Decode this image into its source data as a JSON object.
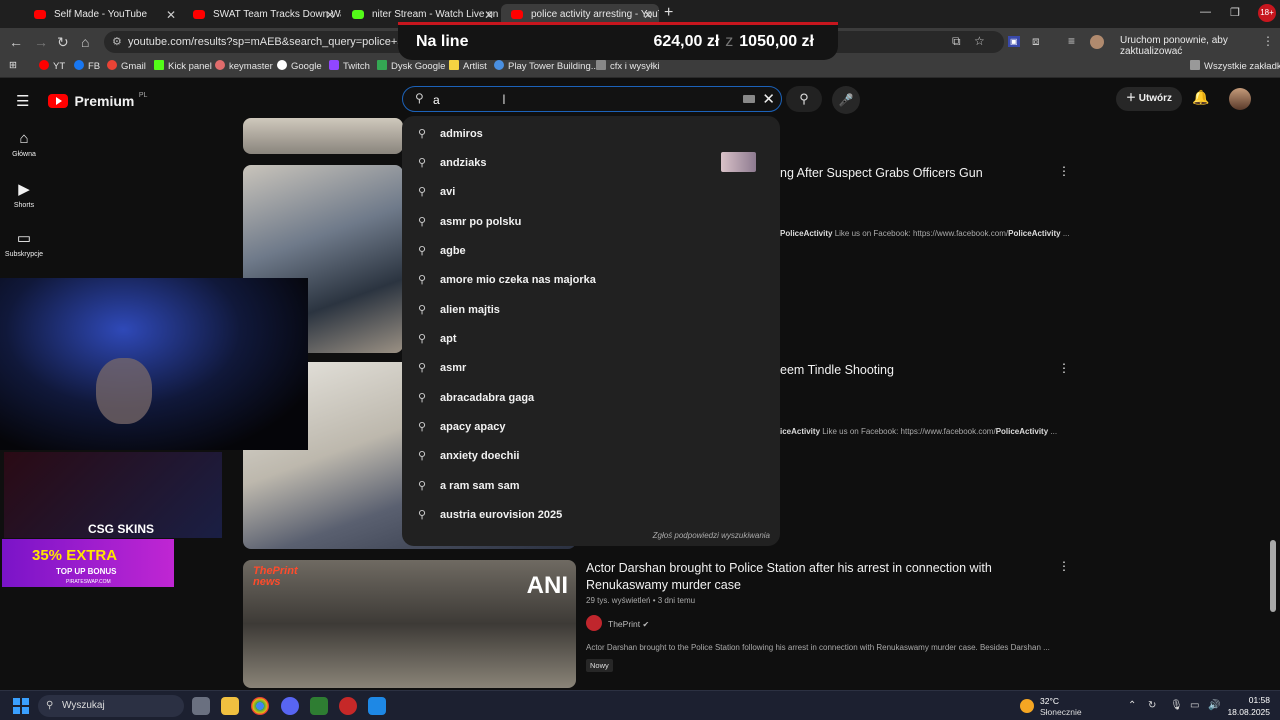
{
  "browser": {
    "tabs": [
      {
        "title": "Self Made - YouTube",
        "favicon_color": "#ff0000"
      },
      {
        "title": "SWAT Team Tracks Down Want",
        "favicon_color": "#ff0000"
      },
      {
        "title": "niter Stream - Watch Live on Ki",
        "favicon_color": "#53fc18"
      },
      {
        "title": "police activity arresting - YouTu",
        "favicon_color": "#ff0000"
      }
    ],
    "url": "youtube.com/results?sp=mAEB&search_query=police+activity+ar",
    "restart_label": "Uruchom ponownie, aby zaktualizować"
  },
  "bookmarks": [
    {
      "label": "YT",
      "color": "#ff0000"
    },
    {
      "label": "FB",
      "color": "#1877f2"
    },
    {
      "label": "Gmail",
      "color": "#ea4335"
    },
    {
      "label": "Kick panel",
      "color": "#53fc18"
    },
    {
      "label": "keymaster",
      "color": "#e06c6c"
    },
    {
      "label": "Google",
      "color": "#ffffff"
    },
    {
      "label": "Twitch",
      "color": "#9146ff"
    },
    {
      "label": "Dysk Google",
      "color": "#34a853"
    },
    {
      "label": "Artlist",
      "color": "#f5d442"
    },
    {
      "label": "Play Tower Building...",
      "color": "#4a90e2"
    },
    {
      "label": "cfx i wysyłki",
      "color": "#888888"
    }
  ],
  "all_bookmarks": "Wszystkie zakładki",
  "overlay_banner": {
    "label": "Na line",
    "value1": "624,00 zł",
    "separator": "z",
    "value2": "1050,00 zł"
  },
  "yt_header": {
    "logo_text": "Premium",
    "logo_region": "PL",
    "search_value": "a",
    "create_label": "Utwórz"
  },
  "sidebar": [
    {
      "label": "Główna",
      "icon": "home-icon"
    },
    {
      "label": "Shorts",
      "icon": "shorts-icon"
    },
    {
      "label": "Subskrypcje",
      "icon": "subscriptions-icon"
    }
  ],
  "suggestions": [
    "admiros",
    "andziaks",
    "avi",
    "asmr po polsku",
    "agbe",
    "amore mio czeka nas majorka",
    "alien majtis",
    "apt",
    "asmr",
    "abracadabra gaga",
    "apacy apacy",
    "anxiety doechii",
    "a ram sam sam",
    "austria eurovision 2025"
  ],
  "report_suggestions": "Zgłoś podpowiedzi wyszukiwania",
  "results": [
    {
      "title_fragment": "ng After Suspect Grabs Officers Gun",
      "desc_channel": "PoliceActivity",
      "desc_text": " Like us on Facebook: https://www.facebook.com/",
      "desc_link": "PoliceActivity",
      "desc_end": " ..."
    },
    {
      "title_fragment": "eem Tindle Shooting",
      "desc_channel": "iceActivity",
      "desc_text": " Like us on Facebook: https://www.facebook.com/",
      "desc_link": "PoliceActivity",
      "desc_end": " ..."
    },
    {
      "title": "Actor Darshan brought to Police Station after his arrest in connection with Renukaswamy murder case",
      "views": "29 tys. wyświetleń",
      "age": "3 dni temu",
      "channel": "ThePrint",
      "desc": "Actor Darshan brought to the Police Station following his arrest in connection with Renukaswamy murder case. Besides Darshan ...",
      "badge": "Nowy",
      "thumb_logo": "ThePrint news",
      "thumb_ani": "ANI"
    }
  ],
  "ads": {
    "csg": "CSG SKINS",
    "promo_line1": "35% EXTRA",
    "promo_line2": "TOP UP BONUS",
    "promo_line3": "PIRATESWAP.COM"
  },
  "taskbar": {
    "search_label": "Wyszukaj",
    "temperature": "32°C",
    "condition": "Słonecznie",
    "time": "01:58",
    "date": "18.08.2025"
  }
}
